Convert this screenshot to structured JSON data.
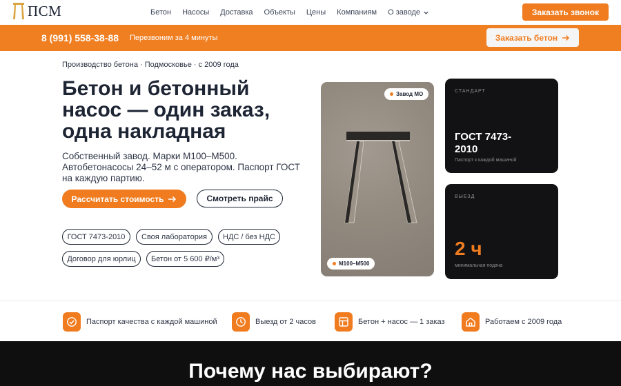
{
  "header": {
    "logo_text": "ПСМ",
    "nav": [
      "Бетон",
      "Насосы",
      "Доставка",
      "Объекты",
      "Цены",
      "Компаниям",
      "О заводе"
    ],
    "call_button": "Заказать звонок"
  },
  "topbar": {
    "phone": "8 (991) 558-38-88",
    "callback_text": "Перезвоним за 4 минуты",
    "order_button": "Заказать бетон"
  },
  "hero": {
    "eyebrow": "Производство бетона · Подмосковье · с 2009 года",
    "title": "Бетон и бетонный насос — один заказ, одна накладная",
    "description": "Собственный завод. Марки М100–М500. Автобетонасосы 24–52 м с оператором. Паспорт ГОСТ на каждую партию.",
    "primary_button": "Рассчитать стоимость",
    "secondary_button": "Смотреть прайс",
    "chips": [
      "ГОСТ 7473-2010",
      "Своя лаборатория",
      "НДС / без НДС",
      "Договор для юрлиц",
      "Бетон от 5 600 ₽/м³"
    ]
  },
  "visual": {
    "tag_top": "Завод МО",
    "tag_bottom": "М100–М500",
    "card_standard": {
      "label": "СТАНДАРТ",
      "value": "ГОСТ 7473-2010",
      "sub": "Паспорт к каждой машиной"
    },
    "card_departure": {
      "label": "ВЫЕЗД",
      "value": "2 ч",
      "sub": "минимальная подача"
    }
  },
  "features": [
    {
      "icon": "check-badge-icon",
      "text": "Паспорт качества с каждой машиной"
    },
    {
      "icon": "clock-icon",
      "text": "Выезд от 2 часов"
    },
    {
      "icon": "grid-icon",
      "text": "Бетон + насос — 1 заказ"
    },
    {
      "icon": "home-icon",
      "text": "Работаем с 2009 года"
    }
  ],
  "why_title": "Почему нас выбирают?",
  "colors": {
    "accent": "#f07c1f",
    "dark": "#121214",
    "text": "#1d2433"
  }
}
